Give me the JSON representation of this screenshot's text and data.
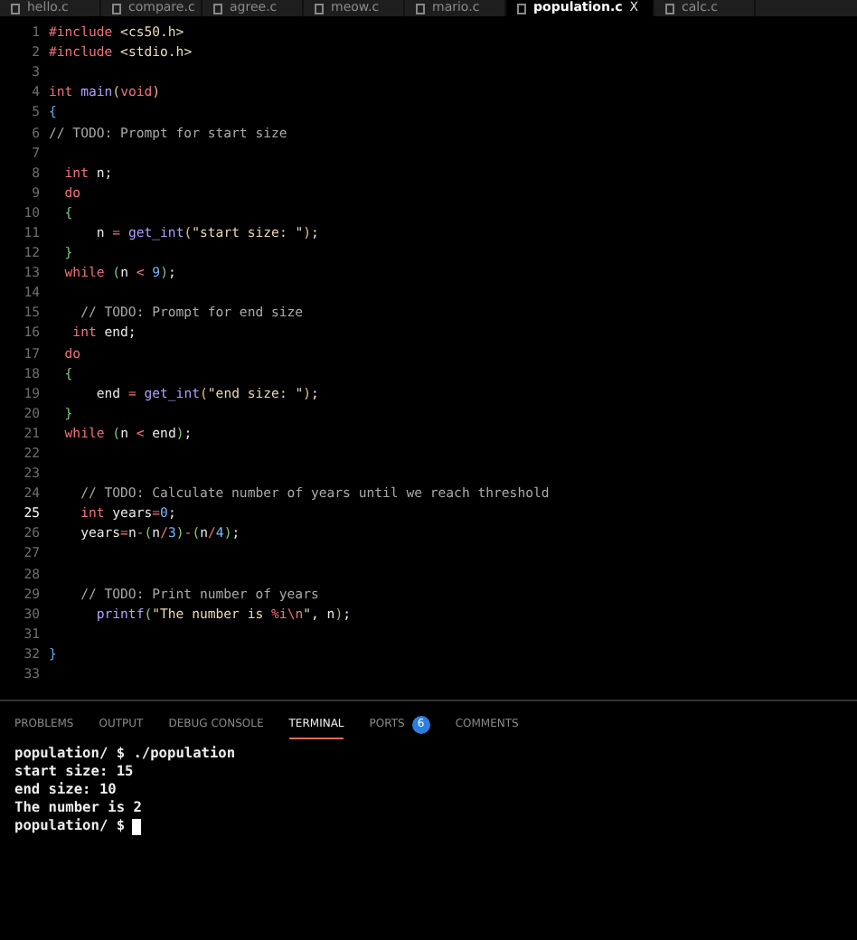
{
  "tabs": [
    {
      "label": "hello.c",
      "selected": false
    },
    {
      "label": "compare.c",
      "selected": false
    },
    {
      "label": "agree.c",
      "selected": false
    },
    {
      "label": "meow.c",
      "selected": false
    },
    {
      "label": "mario.c",
      "selected": false
    },
    {
      "label": "population.c",
      "selected": true,
      "close": "X"
    },
    {
      "label": "calc.c",
      "selected": false
    }
  ],
  "code": [
    {
      "num": "1",
      "current": false,
      "tokens": [
        {
          "kind": "pre",
          "text": "#include"
        },
        {
          "kind": "str",
          "text": " <cs50.h>"
        }
      ]
    },
    {
      "num": "2",
      "current": false,
      "tokens": [
        {
          "kind": "pre",
          "text": "#include"
        },
        {
          "kind": "str",
          "text": " <stdio.h>"
        }
      ]
    },
    {
      "num": "3",
      "current": false
    },
    {
      "num": "4",
      "current": false,
      "tokens": [
        {
          "kind": "kw",
          "text": "int"
        },
        {
          "kind": "fn",
          "text": " main"
        },
        {
          "kind": "br1",
          "text": "("
        },
        {
          "kind": "kw",
          "text": "void"
        },
        {
          "kind": "br1",
          "text": ")"
        }
      ]
    },
    {
      "num": "5",
      "current": false,
      "tokens": [
        {
          "kind": "br2",
          "text": "{"
        }
      ]
    },
    {
      "num": "6",
      "current": false,
      "tokens": [
        {
          "kind": "com",
          "text": "// TODO: Prompt for start size"
        }
      ]
    },
    {
      "num": "7",
      "current": false
    },
    {
      "num": "8",
      "current": false,
      "tokens": [
        {
          "kind": "kw",
          "text": "  int"
        },
        {
          "kind": "plain",
          "text": " n;"
        }
      ]
    },
    {
      "num": "9",
      "current": false,
      "tokens": [
        {
          "kind": "kw",
          "text": "  do"
        }
      ]
    },
    {
      "num": "10",
      "current": false,
      "tokens": [
        {
          "kind": "br3",
          "text": "  {"
        }
      ]
    },
    {
      "num": "11",
      "current": false,
      "tokens": [
        {
          "kind": "plain",
          "text": "      n "
        },
        {
          "kind": "op",
          "text": "="
        },
        {
          "kind": "fn",
          "text": " get_int"
        },
        {
          "kind": "br1",
          "text": "("
        },
        {
          "kind": "str",
          "text": "\"start size: \""
        },
        {
          "kind": "br1",
          "text": ")"
        },
        {
          "kind": "plain",
          "text": ";"
        }
      ]
    },
    {
      "num": "12",
      "current": false,
      "tokens": [
        {
          "kind": "br3",
          "text": "  }"
        }
      ]
    },
    {
      "num": "13",
      "current": false,
      "tokens": [
        {
          "kind": "kw",
          "text": "  while"
        },
        {
          "kind": "br3",
          "text": " ("
        },
        {
          "kind": "plain",
          "text": "n "
        },
        {
          "kind": "op",
          "text": "<"
        },
        {
          "kind": "num",
          "text": " 9"
        },
        {
          "kind": "br3",
          "text": ")"
        },
        {
          "kind": "plain",
          "text": ";"
        }
      ]
    },
    {
      "num": "14",
      "current": false
    },
    {
      "num": "15",
      "current": false,
      "tokens": [
        {
          "kind": "com",
          "text": "    // TODO: Prompt for end size"
        }
      ]
    },
    {
      "num": "16",
      "current": false,
      "tokens": [
        {
          "kind": "kw",
          "text": "   int"
        },
        {
          "kind": "plain",
          "text": " end;"
        }
      ]
    },
    {
      "num": "17",
      "current": false,
      "tokens": [
        {
          "kind": "kw",
          "text": "  do"
        }
      ]
    },
    {
      "num": "18",
      "current": false,
      "tokens": [
        {
          "kind": "br3",
          "text": "  {"
        }
      ]
    },
    {
      "num": "19",
      "current": false,
      "tokens": [
        {
          "kind": "plain",
          "text": "      end "
        },
        {
          "kind": "op",
          "text": "="
        },
        {
          "kind": "fn",
          "text": " get_int"
        },
        {
          "kind": "br1",
          "text": "("
        },
        {
          "kind": "str",
          "text": "\"end size: \""
        },
        {
          "kind": "br1",
          "text": ")"
        },
        {
          "kind": "plain",
          "text": ";"
        }
      ]
    },
    {
      "num": "20",
      "current": false,
      "tokens": [
        {
          "kind": "br3",
          "text": "  }"
        }
      ]
    },
    {
      "num": "21",
      "current": false,
      "tokens": [
        {
          "kind": "kw",
          "text": "  while"
        },
        {
          "kind": "br3",
          "text": " ("
        },
        {
          "kind": "plain",
          "text": "n "
        },
        {
          "kind": "op",
          "text": "<"
        },
        {
          "kind": "plain",
          "text": " end"
        },
        {
          "kind": "br3",
          "text": ")"
        },
        {
          "kind": "plain",
          "text": ";"
        }
      ]
    },
    {
      "num": "22",
      "current": false
    },
    {
      "num": "23",
      "current": false
    },
    {
      "num": "24",
      "current": false,
      "tokens": [
        {
          "kind": "com",
          "text": "    // TODO: Calculate number of years until we reach threshold"
        }
      ]
    },
    {
      "num": "25",
      "current": true,
      "tokens": [
        {
          "kind": "kw",
          "text": "    int"
        },
        {
          "kind": "plain",
          "text": " years"
        },
        {
          "kind": "op",
          "text": "="
        },
        {
          "kind": "num",
          "text": "0"
        },
        {
          "kind": "plain",
          "text": ";"
        }
      ]
    },
    {
      "num": "26",
      "current": false,
      "tokens": [
        {
          "kind": "plain",
          "text": "    years"
        },
        {
          "kind": "op",
          "text": "="
        },
        {
          "kind": "plain",
          "text": "n"
        },
        {
          "kind": "op",
          "text": "-"
        },
        {
          "kind": "br3",
          "text": "("
        },
        {
          "kind": "plain",
          "text": "n"
        },
        {
          "kind": "op",
          "text": "/"
        },
        {
          "kind": "num",
          "text": "3"
        },
        {
          "kind": "br3",
          "text": ")"
        },
        {
          "kind": "op",
          "text": "-"
        },
        {
          "kind": "br3",
          "text": "("
        },
        {
          "kind": "plain",
          "text": "n"
        },
        {
          "kind": "op",
          "text": "/"
        },
        {
          "kind": "num",
          "text": "4"
        },
        {
          "kind": "br3",
          "text": ")"
        },
        {
          "kind": "plain",
          "text": ";"
        }
      ]
    },
    {
      "num": "27",
      "current": false
    },
    {
      "num": "28",
      "current": false
    },
    {
      "num": "29",
      "current": false,
      "tokens": [
        {
          "kind": "com",
          "text": "    // TODO: Print number of years"
        }
      ]
    },
    {
      "num": "30",
      "current": false,
      "tokens": [
        {
          "kind": "fn",
          "text": "      printf"
        },
        {
          "kind": "br3",
          "text": "("
        },
        {
          "kind": "str",
          "text": "\"The number is "
        },
        {
          "kind": "esc",
          "text": "%i\\n"
        },
        {
          "kind": "str",
          "text": "\""
        },
        {
          "kind": "plain",
          "text": ", n"
        },
        {
          "kind": "br3",
          "text": ")"
        },
        {
          "kind": "plain",
          "text": ";"
        }
      ]
    },
    {
      "num": "31",
      "current": false
    },
    {
      "num": "32",
      "current": false,
      "tokens": [
        {
          "kind": "br2",
          "text": "}"
        }
      ]
    },
    {
      "num": "33",
      "current": false
    }
  ],
  "panel_tabs": [
    {
      "label": "PROBLEMS",
      "selected": false
    },
    {
      "label": "OUTPUT",
      "selected": false
    },
    {
      "label": "DEBUG CONSOLE",
      "selected": false
    },
    {
      "label": "TERMINAL",
      "selected": true
    },
    {
      "label": "PORTS",
      "selected": false,
      "badge": "6"
    },
    {
      "label": "COMMENTS",
      "selected": false
    }
  ],
  "terminal": {
    "lines": [
      "population/ $ ./population",
      "start size: 15",
      "end size: 10",
      "The number is 2"
    ],
    "prompt": "population/ $"
  }
}
